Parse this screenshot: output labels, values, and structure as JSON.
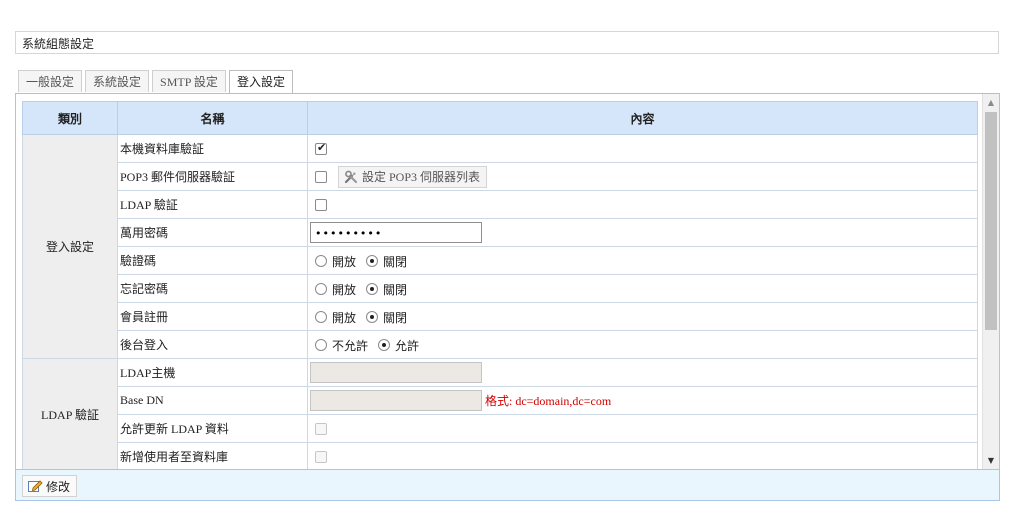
{
  "page_title": "系統組態設定",
  "tabs": [
    {
      "label": "一般設定",
      "active": false
    },
    {
      "label": "系統設定",
      "active": false
    },
    {
      "label": "SMTP 設定",
      "active": false
    },
    {
      "label": "登入設定",
      "active": true
    }
  ],
  "table": {
    "headers": {
      "category": "類別",
      "name": "名稱",
      "content": "內容"
    },
    "groups": [
      {
        "category": "登入設定",
        "rows": [
          {
            "name": "本機資料庫驗証",
            "type": "checkbox",
            "checked": true
          },
          {
            "name": "POP3 郵件伺服器驗証",
            "type": "checkbox-button",
            "checked": false,
            "button_label": "設定 POP3 伺服器列表",
            "button_icon": "tools-icon"
          },
          {
            "name": "LDAP 驗証",
            "type": "checkbox",
            "checked": false
          },
          {
            "name": "萬用密碼",
            "type": "password",
            "value": "•••••••••"
          },
          {
            "name": "驗證碼",
            "type": "radio",
            "options": [
              "開放",
              "關閉"
            ],
            "selected": "關閉"
          },
          {
            "name": "忘記密碼",
            "type": "radio",
            "options": [
              "開放",
              "關閉"
            ],
            "selected": "關閉"
          },
          {
            "name": "會員註冊",
            "type": "radio",
            "options": [
              "開放",
              "關閉"
            ],
            "selected": "關閉"
          },
          {
            "name": "後台登入",
            "type": "radio",
            "options": [
              "不允許",
              "允許"
            ],
            "selected": "允許"
          }
        ]
      },
      {
        "category": "LDAP 驗証",
        "rows": [
          {
            "name": "LDAP主機",
            "type": "text-disabled",
            "value": ""
          },
          {
            "name": "Base DN",
            "type": "text-disabled",
            "value": "",
            "hint": "格式: dc=domain,dc=com"
          },
          {
            "name": "允許更新 LDAP 資料",
            "type": "checkbox-disabled",
            "checked": false
          },
          {
            "name": "新增使用者至資料庫",
            "type": "checkbox-disabled",
            "checked": false
          }
        ]
      }
    ]
  },
  "footer": {
    "save_label": "修改",
    "save_icon": "edit-icon"
  },
  "colors": {
    "header_bg": "#d6e6fa",
    "hint": "#d40000",
    "footer_bg": "#eaf6fe",
    "category_bg": "#eeeeee"
  }
}
